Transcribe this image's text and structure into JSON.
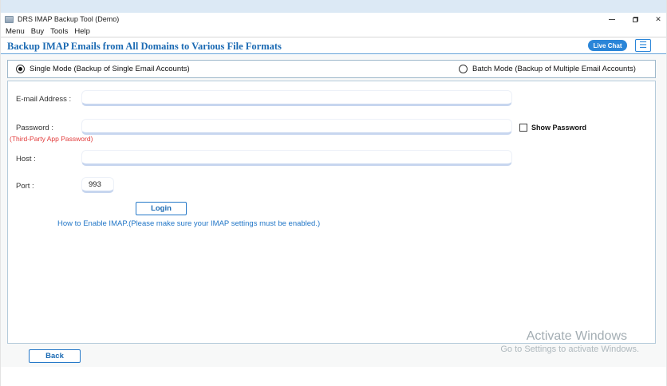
{
  "window": {
    "title": "DRS IMAP Backup Tool (Demo)",
    "controls": {
      "close_glyph": "✕"
    }
  },
  "menu_bar": {
    "items": [
      "Menu",
      "Buy",
      "Tools",
      "Help"
    ]
  },
  "header": {
    "title": "Backup IMAP Emails from All Domains to Various File Formats",
    "live_chat_label": "Live Chat",
    "menu_toggle_glyph": "☰"
  },
  "mode_bar": {
    "single": {
      "label": "Single Mode (Backup of Single Email Accounts)",
      "selected": true
    },
    "batch": {
      "label": "Batch Mode (Backup of Multiple Email Accounts)",
      "selected": false
    }
  },
  "form": {
    "email": {
      "label": "E-mail Address :",
      "value": ""
    },
    "password": {
      "label": "Password :",
      "note": "(Third-Party App Password)",
      "value": "",
      "show_password_label": "Show Password",
      "show_password_checked": false
    },
    "host": {
      "label": "Host :",
      "value": ""
    },
    "port": {
      "label": "Port :",
      "value": "993"
    },
    "login_label": "Login",
    "help_text": "How to Enable IMAP.(Please make sure your IMAP settings must be enabled.)"
  },
  "watermark": {
    "line1": "Activate Windows",
    "line2": "Go to Settings to activate Windows."
  },
  "footer": {
    "back_label": "Back"
  },
  "colors": {
    "accent_blue": "#2a85d8",
    "heading_blue": "#1b6ab3",
    "note_red": "#e23b3b",
    "input_border": "#c7d6ef",
    "watermark_gray": "#a3adb3"
  }
}
